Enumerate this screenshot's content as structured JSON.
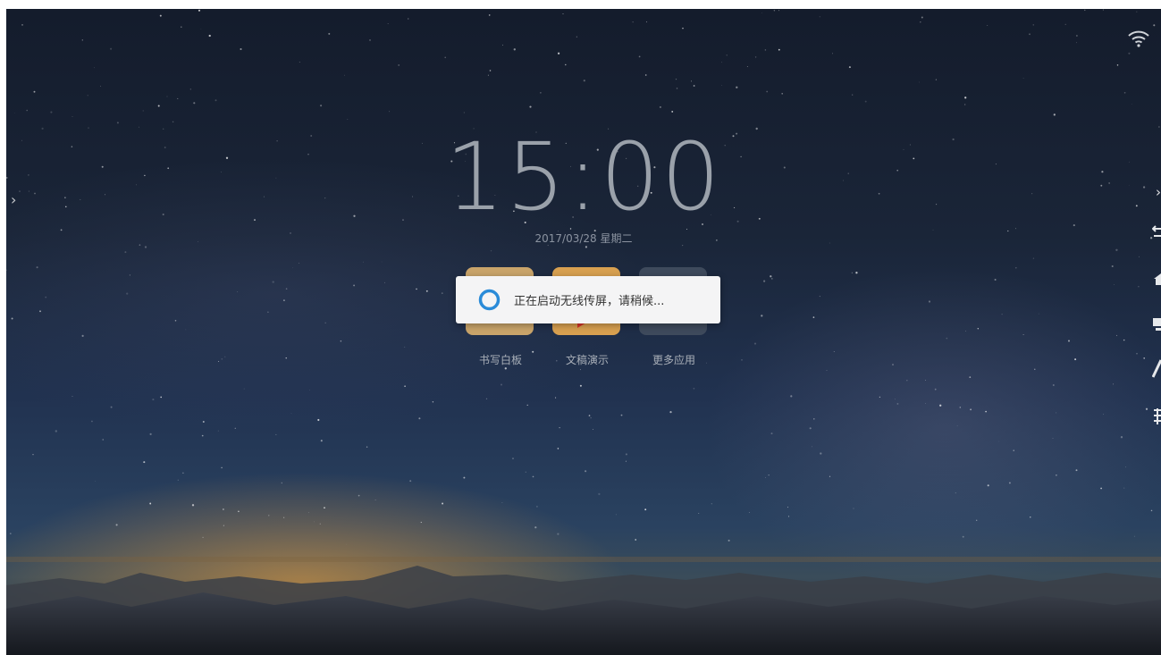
{
  "clock": {
    "time": "15:00",
    "date": "2017/03/28 星期二"
  },
  "apps": [
    {
      "label": "书写白板",
      "icon": "whiteboard-icon",
      "color": "#c9a46a"
    },
    {
      "label": "文稿演示",
      "icon": "presentation-icon",
      "color": "#d8a050"
    },
    {
      "label": "更多应用",
      "icon": "more-apps-icon",
      "color": "#3e4a5c"
    }
  ],
  "toast": {
    "message": "正在启动无线传屏，请稍候...",
    "spinner_color": "#2a8bd8"
  },
  "status": {
    "wifi_icon": "wifi-icon"
  },
  "edge": {
    "left_arrow": "›",
    "right_arrow": "›"
  }
}
